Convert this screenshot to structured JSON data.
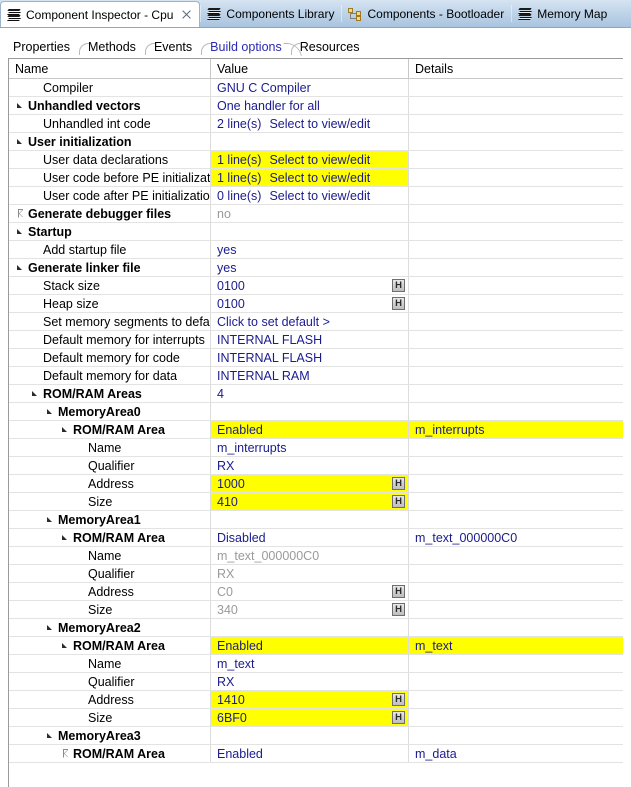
{
  "editor_tabs": [
    {
      "label": "Component Inspector - Cpu",
      "icon": "component-stack-icon",
      "active": true,
      "closable": true
    },
    {
      "label": "Components Library",
      "icon": "component-stack-icon",
      "active": false,
      "closable": false
    },
    {
      "label": "Components - Bootloader",
      "icon": "component-tree-icon",
      "active": false,
      "closable": false
    },
    {
      "label": "Memory Map",
      "icon": "component-stack-icon",
      "active": false,
      "closable": false
    }
  ],
  "form_tabs": [
    {
      "label": "Properties",
      "active": false
    },
    {
      "label": "Methods",
      "active": false
    },
    {
      "label": "Events",
      "active": false
    },
    {
      "label": "Build options",
      "active": true
    },
    {
      "label": "Resources",
      "active": false
    }
  ],
  "columns": {
    "name": "Name",
    "value": "Value",
    "details": "Details"
  },
  "colors": {
    "highlight": "#ffff00",
    "value_text": "#1b1b8f",
    "disabled_text": "#9a9a9a",
    "active_tab_text": "#2a2ab0"
  },
  "rows": [
    {
      "indent": 1,
      "twisty": "none",
      "name": "Compiler",
      "value": "GNU C Compiler",
      "link": "",
      "details": "",
      "bold": false,
      "dim": false,
      "hl_value": false,
      "hl_details": false,
      "hbtn": false
    },
    {
      "indent": 0,
      "twisty": "open",
      "name": "Unhandled vectors",
      "value": "One handler for all",
      "link": "",
      "details": "",
      "bold": true,
      "dim": false,
      "hl_value": false,
      "hl_details": false,
      "hbtn": false
    },
    {
      "indent": 1,
      "twisty": "none",
      "name": "Unhandled int code",
      "value": "2 line(s)",
      "link": "Select to view/edit",
      "details": "",
      "bold": false,
      "dim": false,
      "hl_value": false,
      "hl_details": false,
      "hbtn": false
    },
    {
      "indent": 0,
      "twisty": "open",
      "name": "User initialization",
      "value": "",
      "link": "",
      "details": "",
      "bold": true,
      "dim": false,
      "hl_value": false,
      "hl_details": false,
      "hbtn": false
    },
    {
      "indent": 1,
      "twisty": "none",
      "name": "User data declarations",
      "value": "1 line(s)",
      "link": "Select to view/edit",
      "details": "",
      "bold": false,
      "dim": false,
      "hl_value": true,
      "hl_details": false,
      "hbtn": false
    },
    {
      "indent": 1,
      "twisty": "none",
      "name": "User code before PE initializat",
      "value": "1 line(s)",
      "link": "Select to view/edit",
      "details": "",
      "bold": false,
      "dim": false,
      "hl_value": true,
      "hl_details": false,
      "hbtn": false
    },
    {
      "indent": 1,
      "twisty": "none",
      "name": "User code after PE initializatio",
      "value": "0 line(s)",
      "link": "Select to view/edit",
      "details": "",
      "bold": false,
      "dim": false,
      "hl_value": false,
      "hl_details": false,
      "hbtn": false
    },
    {
      "indent": 0,
      "twisty": "closed",
      "name": "Generate debugger files",
      "value": "no",
      "link": "",
      "details": "",
      "bold": true,
      "dim": true,
      "hl_value": false,
      "hl_details": false,
      "hbtn": false
    },
    {
      "indent": 0,
      "twisty": "open",
      "name": "Startup",
      "value": "",
      "link": "",
      "details": "",
      "bold": true,
      "dim": false,
      "hl_value": false,
      "hl_details": false,
      "hbtn": false
    },
    {
      "indent": 1,
      "twisty": "none",
      "name": "Add startup file",
      "value": "yes",
      "link": "",
      "details": "",
      "bold": false,
      "dim": false,
      "hl_value": false,
      "hl_details": false,
      "hbtn": false
    },
    {
      "indent": 0,
      "twisty": "open",
      "name": "Generate linker file",
      "value": "yes",
      "link": "",
      "details": "",
      "bold": true,
      "dim": false,
      "hl_value": false,
      "hl_details": false,
      "hbtn": false
    },
    {
      "indent": 1,
      "twisty": "none",
      "name": "Stack size",
      "value": "0100",
      "link": "",
      "details": "",
      "bold": false,
      "dim": false,
      "hl_value": false,
      "hl_details": false,
      "hbtn": true,
      "hbtn_label": "H"
    },
    {
      "indent": 1,
      "twisty": "none",
      "name": "Heap size",
      "value": "0100",
      "link": "",
      "details": "",
      "bold": false,
      "dim": false,
      "hl_value": false,
      "hl_details": false,
      "hbtn": true,
      "hbtn_label": "H"
    },
    {
      "indent": 1,
      "twisty": "none",
      "name": "Set memory segments to default",
      "value": "Click to set default >",
      "link": "",
      "details": "",
      "bold": false,
      "dim": false,
      "hl_value": false,
      "hl_details": false,
      "hbtn": false
    },
    {
      "indent": 1,
      "twisty": "none",
      "name": "Default memory for interrupts",
      "value": "INTERNAL FLASH",
      "link": "",
      "details": "",
      "bold": false,
      "dim": false,
      "hl_value": false,
      "hl_details": false,
      "hbtn": false
    },
    {
      "indent": 1,
      "twisty": "none",
      "name": "Default memory for code",
      "value": "INTERNAL FLASH",
      "link": "",
      "details": "",
      "bold": false,
      "dim": false,
      "hl_value": false,
      "hl_details": false,
      "hbtn": false
    },
    {
      "indent": 1,
      "twisty": "none",
      "name": "Default memory for data",
      "value": "INTERNAL RAM",
      "link": "",
      "details": "",
      "bold": false,
      "dim": false,
      "hl_value": false,
      "hl_details": false,
      "hbtn": false
    },
    {
      "indent": 1,
      "twisty": "open",
      "name": "ROM/RAM Areas",
      "value": "4",
      "link": "",
      "details": "",
      "bold": true,
      "dim": false,
      "hl_value": false,
      "hl_details": false,
      "hbtn": false
    },
    {
      "indent": 2,
      "twisty": "open",
      "name": "MemoryArea0",
      "value": "",
      "link": "",
      "details": "",
      "bold": true,
      "dim": false,
      "hl_value": false,
      "hl_details": false,
      "hbtn": false
    },
    {
      "indent": 3,
      "twisty": "open",
      "name": "ROM/RAM Area",
      "value": "Enabled",
      "link": "",
      "details": "m_interrupts",
      "bold": true,
      "dim": false,
      "hl_value": true,
      "hl_details": true,
      "hbtn": false
    },
    {
      "indent": 4,
      "twisty": "none",
      "name": "Name",
      "value": "m_interrupts",
      "link": "",
      "details": "",
      "bold": false,
      "dim": false,
      "hl_value": false,
      "hl_details": false,
      "hbtn": false
    },
    {
      "indent": 4,
      "twisty": "none",
      "name": "Qualifier",
      "value": "RX",
      "link": "",
      "details": "",
      "bold": false,
      "dim": false,
      "hl_value": false,
      "hl_details": false,
      "hbtn": false
    },
    {
      "indent": 4,
      "twisty": "none",
      "name": "Address",
      "value": "1000",
      "link": "",
      "details": "",
      "bold": false,
      "dim": false,
      "hl_value": true,
      "hl_details": false,
      "hbtn": true,
      "hbtn_label": "H"
    },
    {
      "indent": 4,
      "twisty": "none",
      "name": "Size",
      "value": "410",
      "link": "",
      "details": "",
      "bold": false,
      "dim": false,
      "hl_value": true,
      "hl_details": false,
      "hbtn": true,
      "hbtn_label": "H"
    },
    {
      "indent": 2,
      "twisty": "open",
      "name": "MemoryArea1",
      "value": "",
      "link": "",
      "details": "",
      "bold": true,
      "dim": false,
      "hl_value": false,
      "hl_details": false,
      "hbtn": false
    },
    {
      "indent": 3,
      "twisty": "open",
      "name": "ROM/RAM Area",
      "value": "Disabled",
      "link": "",
      "details": "m_text_000000C0",
      "bold": true,
      "dim": false,
      "hl_value": false,
      "hl_details": false,
      "hbtn": false
    },
    {
      "indent": 4,
      "twisty": "none",
      "name": "Name",
      "value": "m_text_000000C0",
      "link": "",
      "details": "",
      "bold": false,
      "dim": true,
      "hl_value": false,
      "hl_details": false,
      "hbtn": false
    },
    {
      "indent": 4,
      "twisty": "none",
      "name": "Qualifier",
      "value": "RX",
      "link": "",
      "details": "",
      "bold": false,
      "dim": true,
      "hl_value": false,
      "hl_details": false,
      "hbtn": false
    },
    {
      "indent": 4,
      "twisty": "none",
      "name": "Address",
      "value": "C0",
      "link": "",
      "details": "",
      "bold": false,
      "dim": true,
      "hl_value": false,
      "hl_details": false,
      "hbtn": true,
      "hbtn_label": "H"
    },
    {
      "indent": 4,
      "twisty": "none",
      "name": "Size",
      "value": "340",
      "link": "",
      "details": "",
      "bold": false,
      "dim": true,
      "hl_value": false,
      "hl_details": false,
      "hbtn": true,
      "hbtn_label": "H"
    },
    {
      "indent": 2,
      "twisty": "open",
      "name": "MemoryArea2",
      "value": "",
      "link": "",
      "details": "",
      "bold": true,
      "dim": false,
      "hl_value": false,
      "hl_details": false,
      "hbtn": false
    },
    {
      "indent": 3,
      "twisty": "open",
      "name": "ROM/RAM Area",
      "value": "Enabled",
      "link": "",
      "details": "m_text",
      "bold": true,
      "dim": false,
      "hl_value": true,
      "hl_details": true,
      "hbtn": false
    },
    {
      "indent": 4,
      "twisty": "none",
      "name": "Name",
      "value": "m_text",
      "link": "",
      "details": "",
      "bold": false,
      "dim": false,
      "hl_value": false,
      "hl_details": false,
      "hbtn": false
    },
    {
      "indent": 4,
      "twisty": "none",
      "name": "Qualifier",
      "value": "RX",
      "link": "",
      "details": "",
      "bold": false,
      "dim": false,
      "hl_value": false,
      "hl_details": false,
      "hbtn": false
    },
    {
      "indent": 4,
      "twisty": "none",
      "name": "Address",
      "value": "1410",
      "link": "",
      "details": "",
      "bold": false,
      "dim": false,
      "hl_value": true,
      "hl_details": false,
      "hbtn": true,
      "hbtn_label": "H"
    },
    {
      "indent": 4,
      "twisty": "none",
      "name": "Size",
      "value": "6BF0",
      "link": "",
      "details": "",
      "bold": false,
      "dim": false,
      "hl_value": true,
      "hl_details": false,
      "hbtn": true,
      "hbtn_label": "H"
    },
    {
      "indent": 2,
      "twisty": "open",
      "name": "MemoryArea3",
      "value": "",
      "link": "",
      "details": "",
      "bold": true,
      "dim": false,
      "hl_value": false,
      "hl_details": false,
      "hbtn": false
    },
    {
      "indent": 3,
      "twisty": "closed",
      "name": "ROM/RAM Area",
      "value": "Enabled",
      "link": "",
      "details": "m_data",
      "bold": true,
      "dim": false,
      "hl_value": false,
      "hl_details": false,
      "hbtn": false
    }
  ]
}
